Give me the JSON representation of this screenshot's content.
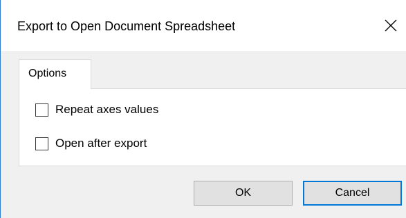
{
  "dialog": {
    "title": "Export to Open Document Spreadsheet",
    "close_icon": "close-icon"
  },
  "tabs": [
    {
      "label": "Options",
      "selected": true
    }
  ],
  "options": [
    {
      "label": "Repeat axes values",
      "checked": false
    },
    {
      "label": "Open after export",
      "checked": false
    }
  ],
  "buttons": {
    "ok_label": "OK",
    "cancel_label": "Cancel"
  },
  "colors": {
    "accent": "#0078d7",
    "window_border": "#2b7fd0",
    "background": "#f0f0f0"
  }
}
